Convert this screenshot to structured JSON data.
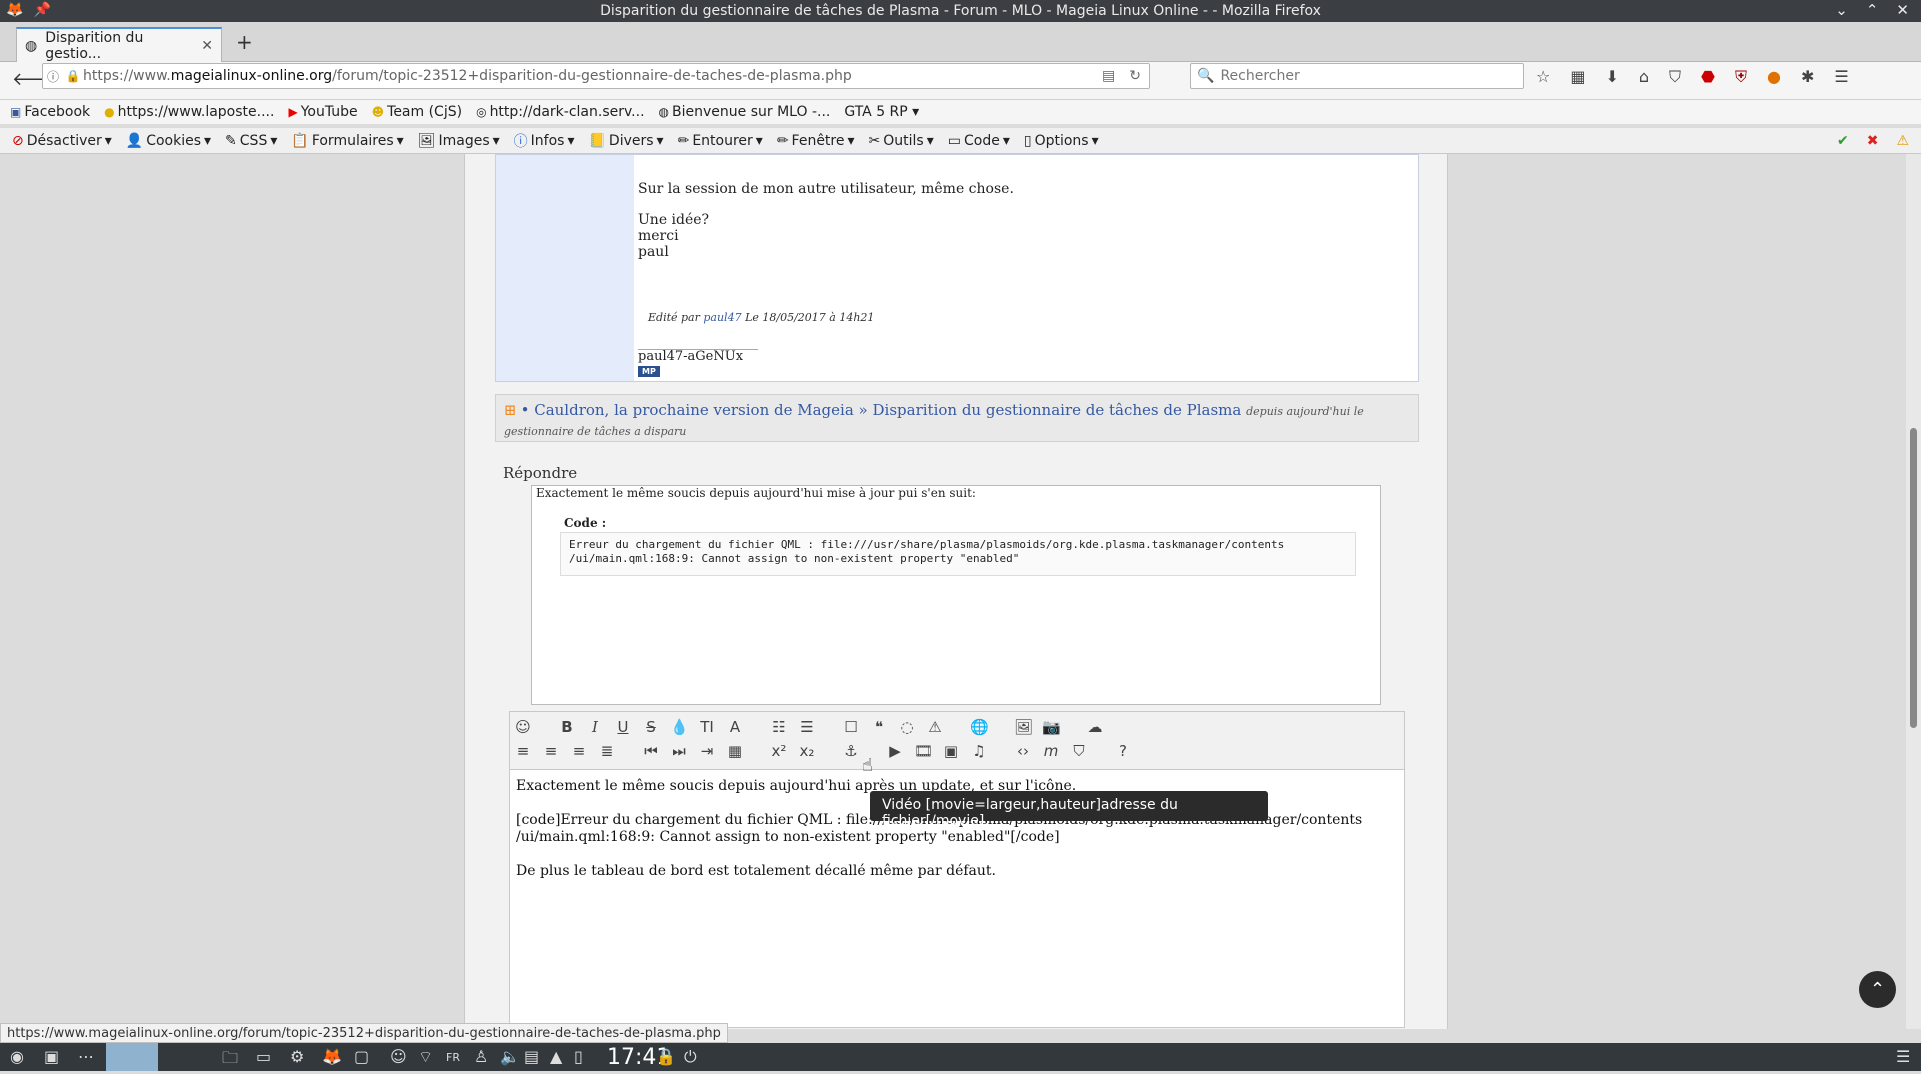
{
  "window": {
    "title": "Disparition du gestionnaire de tâches de Plasma - Forum - MLO - Mageia Linux Online - - Mozilla Firefox"
  },
  "tab": {
    "label": "Disparition du gestio...",
    "new_tab": "+"
  },
  "address": {
    "prefix": "https://www.",
    "host": "mageialinux-online.org",
    "path": "/forum/topic-23512+disparition-du-gestionnaire-de-taches-de-plasma.php"
  },
  "search": {
    "placeholder": "Rechercher"
  },
  "bookmarks": [
    "Facebook",
    "https://www.laposte....",
    "YouTube",
    "Team (CjS)",
    "http://dark-clan.serv...",
    "Bienvenue sur MLO -...",
    "GTA 5 RP"
  ],
  "devtools": [
    "Désactiver",
    "Cookies",
    "CSS",
    "Formulaires",
    "Images",
    "Infos",
    "Divers",
    "Entourer",
    "Fenêtre",
    "Outils",
    "Code",
    "Options"
  ],
  "post": {
    "line1": "Sur la session de mon autre utilisateur, même chose.",
    "line2": "Une idée?",
    "line3": "merci",
    "line4": "paul",
    "edited_prefix": "Edité par",
    "edited_user": "paul47",
    "edited_suffix": "Le 18/05/2017 à 14h21",
    "signature": "paul47-aGeNUx",
    "mp": "MP"
  },
  "breadcrumb": {
    "sep": "•",
    "forum": "Cauldron, la prochaine version de Mageia",
    "arrow": "»",
    "topic": "Disparition du gestionnaire de tâches de Plasma",
    "desc": "depuis aujourd'hui le gestionnaire de tâches a disparu"
  },
  "reply": {
    "title": "Répondre"
  },
  "preview": {
    "intro": "Exactement le même soucis depuis aujourd'hui mise à jour pui s'en suit:",
    "code_label": "Code :",
    "code": "Erreur du chargement du fichier QML : file:///usr/share/plasma/plasmoids/org.kde.plasma.taskmanager/contents\n/ui/main.qml:168:9: Cannot assign to non-existent property \"enabled\""
  },
  "editor": {
    "text": "Exactement le même soucis depuis aujourd'hui après un update, et sur l'icône.\n\n[code]Erreur du chargement du fichier QML : file:///usr/share/plasma/plasmoids/org.kde.plasma.taskmanager/contents\n/ui/main.qml:168:9: Cannot assign to non-existent property \"enabled\"[/code]\n\nDe plus le tableau de bord est totalement décallé même par défaut."
  },
  "tooltip": {
    "text": "Vidéo [movie=largeur,hauteur]adresse du fichier[/movie]"
  },
  "status": {
    "url": "https://www.mageialinux-online.org/forum/topic-23512+disparition-du-gestionnaire-de-taches-de-plasma.php"
  },
  "taskbar": {
    "clock": "17:41",
    "lang": "FR"
  }
}
